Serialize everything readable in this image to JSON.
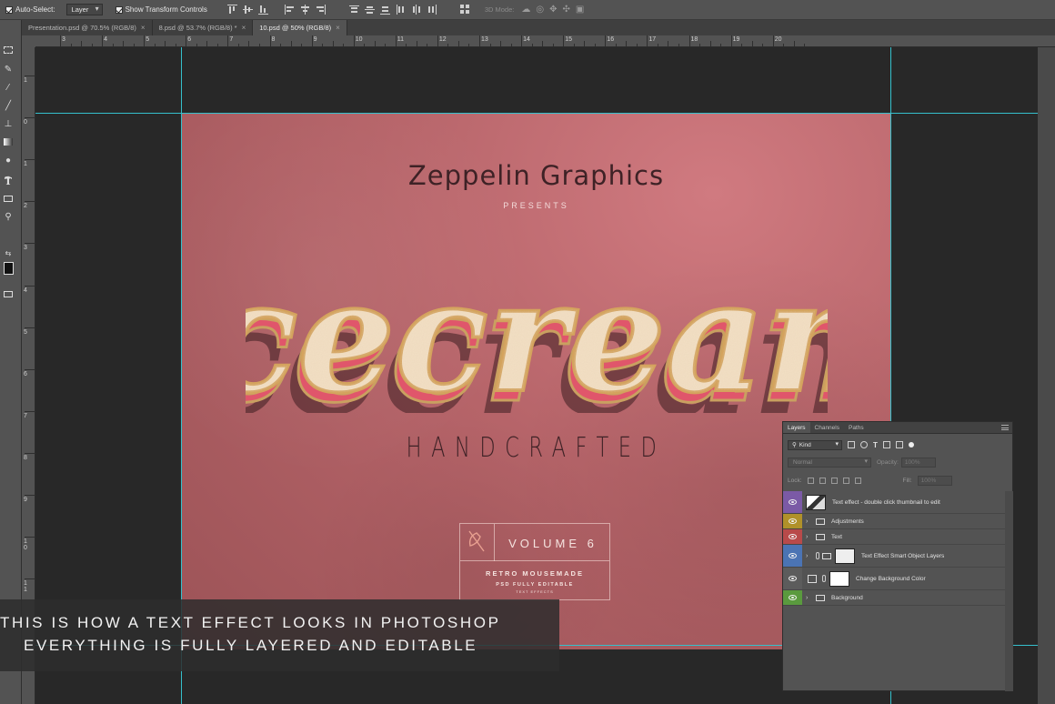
{
  "options_bar": {
    "auto_select_label": "Auto-Select:",
    "auto_select_target": "Layer",
    "show_transform_label": "Show Transform Controls",
    "mode_3d_label": "3D Mode:"
  },
  "tabs": [
    {
      "label": "Presentation.psd @ 70.5% (RGB/8)",
      "close": "×"
    },
    {
      "label": "8.psd @ 53.7% (RGB/8) *",
      "close": "×"
    },
    {
      "label": "10.psd @ 50% (RGB/8)",
      "close": "×"
    }
  ],
  "ruler": {
    "h_labels": [
      "3",
      "4",
      "5",
      "6",
      "7",
      "8",
      "9",
      "10",
      "11",
      "12",
      "13",
      "14",
      "15",
      "16",
      "17",
      "18",
      "19",
      "20"
    ],
    "v_labels": [
      "1",
      "0",
      "1",
      "2",
      "3",
      "4",
      "5",
      "6",
      "7",
      "8",
      "9",
      "10",
      "11"
    ]
  },
  "artwork": {
    "brand": "Zeppelin Graphics",
    "presents": "PRESENTS",
    "hero": "icecream",
    "subtitle": "HANDCRAFTED",
    "badge_volume": "VOLUME 6",
    "badge_line1": "RETRO MOUSEMADE",
    "badge_line2": "PSD FULLY EDITABLE",
    "badge_line3": "TEXT EFFECTS",
    "colors": {
      "background": "#b66469",
      "hero_fill": "#f3e0c4",
      "hero_outline": "#d4a35d",
      "hero_extrude": "#e0566b",
      "ink": "#3e2226"
    }
  },
  "caption": {
    "line1": "THIS IS HOW A TEXT EFFECT LOOKS IN PHOTOSHOP",
    "line2": "EVERYTHING IS FULLY LAYERED AND EDITABLE"
  },
  "layers_panel": {
    "tabs": [
      "Layers",
      "Channels",
      "Paths"
    ],
    "filter_kind": "Kind",
    "blend_mode": "Normal",
    "opacity_label": "Opacity:",
    "opacity_value": "100%",
    "lock_label": "Lock:",
    "fill_label": "Fill:",
    "fill_value": "100%",
    "layers": [
      {
        "name": "Text effect - double click thumbnail to edit",
        "color": "#7b5aa6"
      },
      {
        "name": "Adjustments",
        "color": "#b0912a"
      },
      {
        "name": "Text",
        "color": "#b84a4a"
      },
      {
        "name": "Text Effect Smart Object Layers",
        "color": "#4b74b4"
      },
      {
        "name": "Change Background Color",
        "color": "#5c5c5c"
      },
      {
        "name": "Background",
        "color": "#5a9a3e"
      }
    ]
  }
}
